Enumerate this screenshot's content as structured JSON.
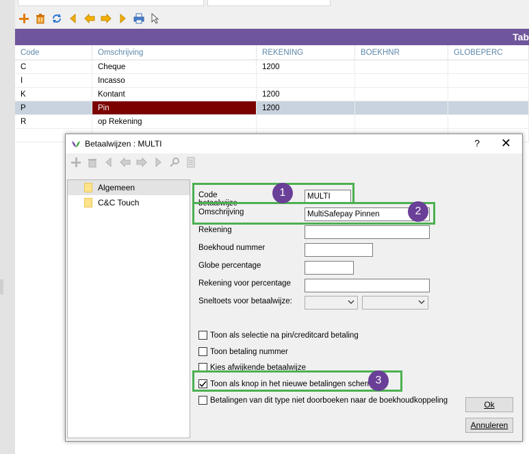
{
  "toolbar": {
    "icons": [
      "add-icon",
      "delete-icon",
      "refresh-icon",
      "first-icon",
      "prev-icon",
      "next-icon",
      "last-icon",
      "print-icon",
      "cursor-icon"
    ]
  },
  "grid": {
    "title": "Tab",
    "columns": [
      "Code",
      "Omschrijving",
      "REKENING",
      "BOEKHNR",
      "GLOBEPERC"
    ],
    "rows": [
      {
        "code": "C",
        "omschrijving": "Cheque",
        "rekening": "1200"
      },
      {
        "code": "I",
        "omschrijving": "Incasso",
        "rekening": ""
      },
      {
        "code": "K",
        "omschrijving": "Kontant",
        "rekening": "1200"
      },
      {
        "code": "P",
        "omschrijving": "Pin",
        "rekening": "1200"
      },
      {
        "code": "R",
        "omschrijving": "op Rekening",
        "rekening": ""
      }
    ],
    "selected_code": "P"
  },
  "dialog": {
    "title": "Betaalwijzen : MULTI",
    "help": "?",
    "close": "✕",
    "tree": [
      {
        "label": "Algemeen",
        "selected": true
      },
      {
        "label": "C&C Touch",
        "selected": false
      }
    ],
    "fields": {
      "code_label": "Code betaalwijze",
      "code_value": "MULTI",
      "omschrijving_label": "Omschrijving",
      "omschrijving_value": "MultiSafepay Pinnen",
      "rekening_label": "Rekening",
      "rekening_value": "",
      "boekhoud_label": "Boekhoud nummer",
      "boekhoud_value": "",
      "globe_label": "Globe percentage",
      "globe_value": "",
      "rek_perc_label": "Rekening voor percentage",
      "rek_perc_value": "",
      "sneltoets_label": "Sneltoets voor betaalwijze:",
      "sneltoets_value": ""
    },
    "checkboxes": [
      {
        "label": "Toon als selectie na pin/creditcard betaling",
        "checked": false
      },
      {
        "label": "Toon betaling nummer",
        "checked": false
      },
      {
        "label": "Kies afwijkende betaalwijze",
        "checked": false
      },
      {
        "label": "Toon als knop in het nieuwe betalingen scherm",
        "checked": true
      },
      {
        "label": "Betalingen van dit type niet doorboeken naar de boekhoudkoppeling",
        "checked": false
      }
    ],
    "ok_label": "Ok",
    "cancel_label": "Annuleren"
  },
  "annotations": {
    "badge1": "1",
    "badge2": "2",
    "badge3": "3",
    "highlight_color": "#4caf50",
    "badge_color": "#6a3f97"
  },
  "colors": {
    "grid_header": "#6f559c",
    "selected_row": "#c8d3df",
    "selected_cell": "#7b0000"
  }
}
